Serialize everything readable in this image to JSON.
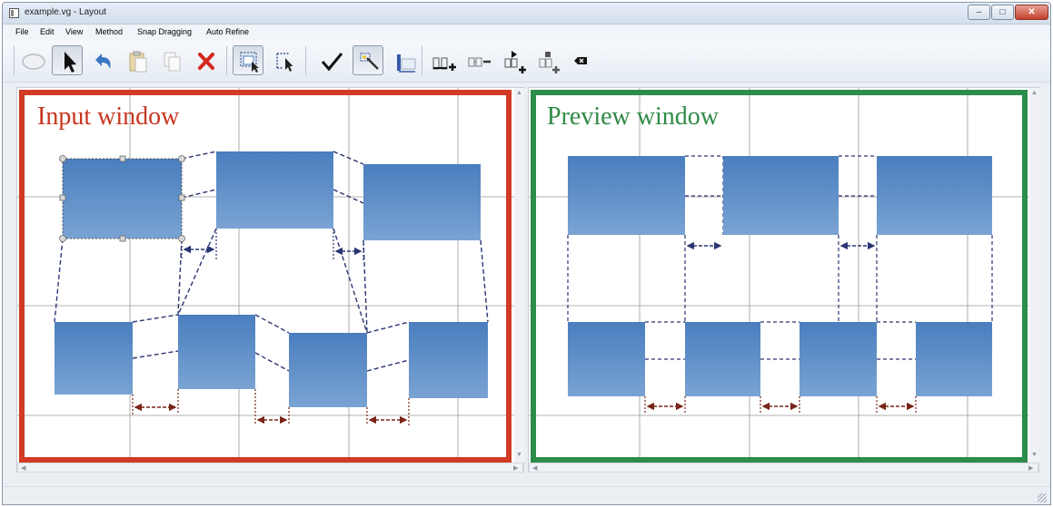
{
  "window": {
    "title": "example.vg - Layout"
  },
  "menu": [
    "File",
    "Edit",
    "View",
    "Method",
    "Snap Dragging",
    "Auto Refine"
  ],
  "toolbar": {
    "tools": [
      "ellipse-tool-icon",
      "select-arrow-icon",
      "undo-icon",
      "paste-icon",
      "copy-icon",
      "delete-icon",
      "select-region-icon",
      "select-pointer-icon",
      "check-icon",
      "magic-wand-icon",
      "distribute-icon",
      "add-spacing-icon",
      "remove-spacing-icon",
      "add-node-icon",
      "remove-node-icon",
      "erase-icon"
    ]
  },
  "input_pane": {
    "label": "Input window",
    "frame_color": "#d23a25",
    "label_color": "#c8351f"
  },
  "preview_pane": {
    "label": "Preview window",
    "frame_color": "#2c8c4a",
    "label_color": "#2f8a46"
  },
  "colors": {
    "box_top": "#4a7ebe",
    "box_bottom": "#7aa3d3",
    "navy_dash": "#2a3572",
    "brown_dash": "#7a2418",
    "grid": "#9a9a9a"
  }
}
